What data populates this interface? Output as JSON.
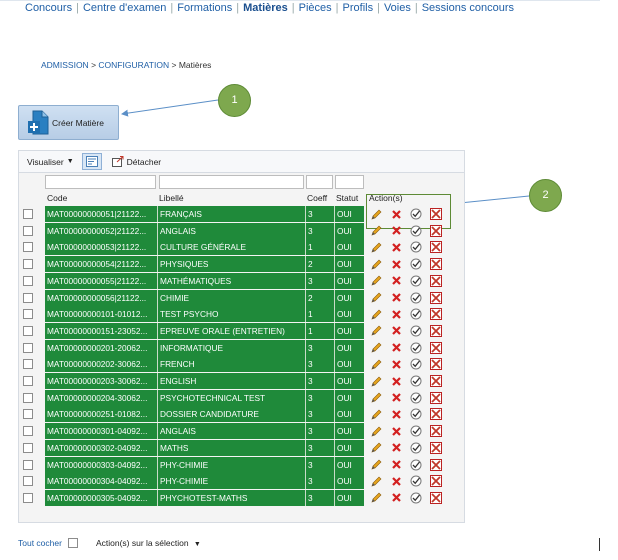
{
  "topnav": [
    "Concours",
    "Centre d'examen",
    "Formations",
    "Matières",
    "Pièces",
    "Profils",
    "Voies",
    "Sessions concours"
  ],
  "topnav_active": "Matières",
  "breadcrumb": {
    "admission": "ADMISSION",
    "config": "CONFIGURATION",
    "current": "Matières",
    "separator": ">"
  },
  "create_button": {
    "label": "Créer Matière"
  },
  "callouts": [
    "1",
    "2"
  ],
  "toolbar": {
    "visualiser": "Visualiser",
    "detacher": "Détacher"
  },
  "columns": {
    "code": "Code",
    "libelle": "Libellé",
    "coeff": "Coeff",
    "statut": "Statut",
    "actions": "Action(s)"
  },
  "rows": [
    {
      "code": "MAT00000000051|21122...",
      "libelle": "FRANÇAIS",
      "coeff": "3",
      "statut": "OUI"
    },
    {
      "code": "MAT00000000052|21122...",
      "libelle": "ANGLAIS",
      "coeff": "3",
      "statut": "OUI"
    },
    {
      "code": "MAT00000000053|21122...",
      "libelle": "CULTURE GÉNÉRALE",
      "coeff": "1",
      "statut": "OUI"
    },
    {
      "code": "MAT00000000054|21122...",
      "libelle": "PHYSIQUES",
      "coeff": "2",
      "statut": "OUI"
    },
    {
      "code": "MAT00000000055|21122...",
      "libelle": "MATHÉMATIQUES",
      "coeff": "3",
      "statut": "OUI"
    },
    {
      "code": "MAT00000000056|21122...",
      "libelle": "CHIMIE",
      "coeff": "2",
      "statut": "OUI"
    },
    {
      "code": "MAT00000000101-01012...",
      "libelle": "TEST PSYCHO",
      "coeff": "1",
      "statut": "OUI"
    },
    {
      "code": "MAT00000000151-23052...",
      "libelle": "EPREUVE ORALE (ENTRETIEN)",
      "coeff": "1",
      "statut": "OUI"
    },
    {
      "code": "MAT00000000201-20062...",
      "libelle": "INFORMATIQUE",
      "coeff": "3",
      "statut": "OUI"
    },
    {
      "code": "MAT00000000202-30062...",
      "libelle": "FRENCH",
      "coeff": "3",
      "statut": "OUI"
    },
    {
      "code": "MAT00000000203-30062...",
      "libelle": "ENGLISH",
      "coeff": "3",
      "statut": "OUI"
    },
    {
      "code": "MAT00000000204-30062...",
      "libelle": "PSYCHOTECHNICAL TEST",
      "coeff": "3",
      "statut": "OUI"
    },
    {
      "code": "MAT00000000251-01082...",
      "libelle": "DOSSIER CANDIDATURE",
      "coeff": "3",
      "statut": "OUI"
    },
    {
      "code": "MAT00000000301-04092...",
      "libelle": "ANGLAIS",
      "coeff": "3",
      "statut": "OUI"
    },
    {
      "code": "MAT00000000302-04092...",
      "libelle": "MATHS",
      "coeff": "3",
      "statut": "OUI"
    },
    {
      "code": "MAT00000000303-04092...",
      "libelle": "PHY-CHIMIE",
      "coeff": "3",
      "statut": "OUI"
    },
    {
      "code": "MAT00000000304-04092...",
      "libelle": "PHY-CHIMIE",
      "coeff": "3",
      "statut": "OUI"
    },
    {
      "code": "MAT00000000305-04092...",
      "libelle": "PHYCHOTEST-MATHS",
      "coeff": "3",
      "statut": "OUI"
    }
  ],
  "row_actions": [
    "edit-icon",
    "delete-icon",
    "validate-icon",
    "disable-icon"
  ],
  "footer": {
    "tout_cocher": "Tout cocher",
    "actions_selection": "Action(s) sur la sélection"
  },
  "colors": {
    "row_green": "#1f8a3a",
    "link_blue": "#1f5fa6",
    "callout_green": "#7ea84e"
  }
}
